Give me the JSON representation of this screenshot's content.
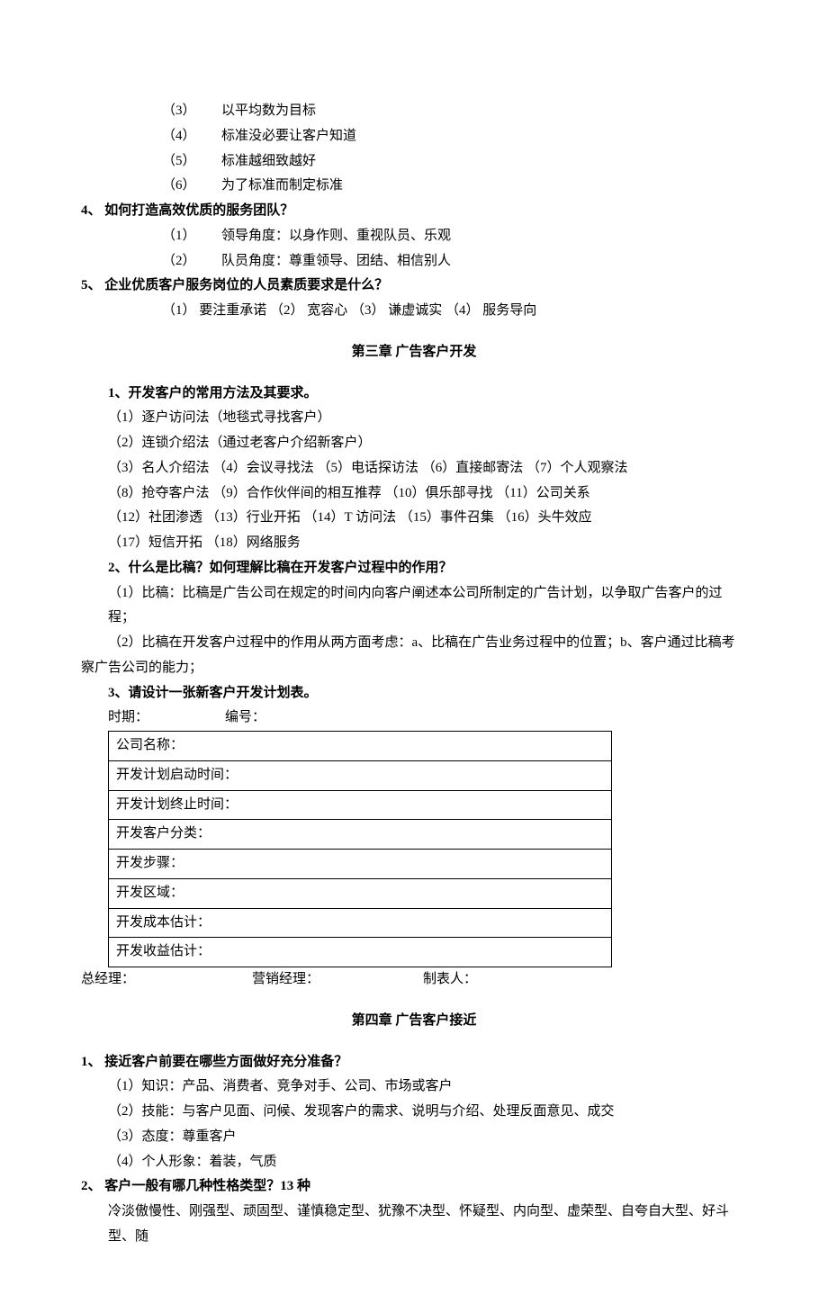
{
  "list_a": [
    {
      "num": "（3）",
      "text": "以平均数为目标"
    },
    {
      "num": "（4）",
      "text": "标准没必要让客户知道"
    },
    {
      "num": "（5）",
      "text": "标准越细致越好"
    },
    {
      "num": "（6）",
      "text": "为了标准而制定标准"
    }
  ],
  "q4": {
    "label": "4、",
    "text": "如何打造高效优质的服务团队？"
  },
  "q4_items": [
    {
      "num": "（1）",
      "text": "领导角度：以身作则、重视队员、乐观"
    },
    {
      "num": "（2）",
      "text": "队员角度：尊重领导、团结、相信别人"
    }
  ],
  "q5": {
    "label": "5、",
    "text": "企业优质客户服务岗位的人员素质要求是什么？"
  },
  "q5_line": "（1）  要注重承诺  （2） 宽容心   （3） 谦虚诚实   （4）  服务导向",
  "chapter3": "第三章 广告客户开发",
  "c3_q1": "1、开发客户的常用方法及其要求。",
  "c3_q1_lines": [
    "（1）逐户访问法（地毯式寻找客户）",
    "（2）连锁介绍法（通过老客户介绍新客户）",
    "（3）名人介绍法   （4）会议寻找法   （5）电话探访法   （6）直接邮寄法   （7）个人观察法",
    "（8）抢夺客户法   （9）合作伙伴间的相互推荐         （10）俱乐部寻找 （11）公司关系",
    "（12）社团渗透    （13）行业开拓    （14）T 访问法    （15）事件召集    （16）头牛效应",
    "（17）短信开拓   （18）网络服务"
  ],
  "c3_q2": "2、什么是比稿？如何理解比稿在开发客户过程中的作用？",
  "c3_q2_lines": [
    "（1）比稿：比稿是广告公司在规定的时间内向客户阐述本公司所制定的广告计划，以争取广告客户的过程；",
    "（2）比稿在开发客户过程中的作用从两方面考虑：a、比稿在广告业务过程中的位置；b、客户通过比稿考察广告公司的能力；"
  ],
  "c3_q3": "3、请设计一张新客户开发计划表。",
  "table_meta": {
    "date": "时期：",
    "number_label": "编号："
  },
  "table_rows": [
    "公司名称：",
    "开发计划启动时间：",
    "开发计划终止时间：",
    "开发客户分类：",
    "开发步骤：",
    "开发区域：",
    "开发成本估计：",
    "开发收益估计："
  ],
  "table_footer": {
    "a": "总经理：",
    "b": "营销经理：",
    "c": "制表人："
  },
  "chapter4": "第四章   广告客户接近",
  "c4_q1": {
    "label": "1、",
    "text": "接近客户前要在哪些方面做好充分准备？"
  },
  "c4_q1_lines": [
    "（1）知识：产品、消费者、竞争对手、公司、市场或客户",
    "（2）技能：与客户见面、问候、发现客户的需求、说明与介绍、处理反面意见、成交",
    "（3）态度：尊重客户",
    "（4）个人形象：着装，气质"
  ],
  "c4_q2": {
    "label": "2、",
    "text": "客户一般有哪几种性格类型？13 种"
  },
  "c4_q2_line": "冷淡傲慢性、刚强型、顽固型、谨慎稳定型、犹豫不决型、怀疑型、内向型、虚荣型、自夸自大型、好斗型、随"
}
